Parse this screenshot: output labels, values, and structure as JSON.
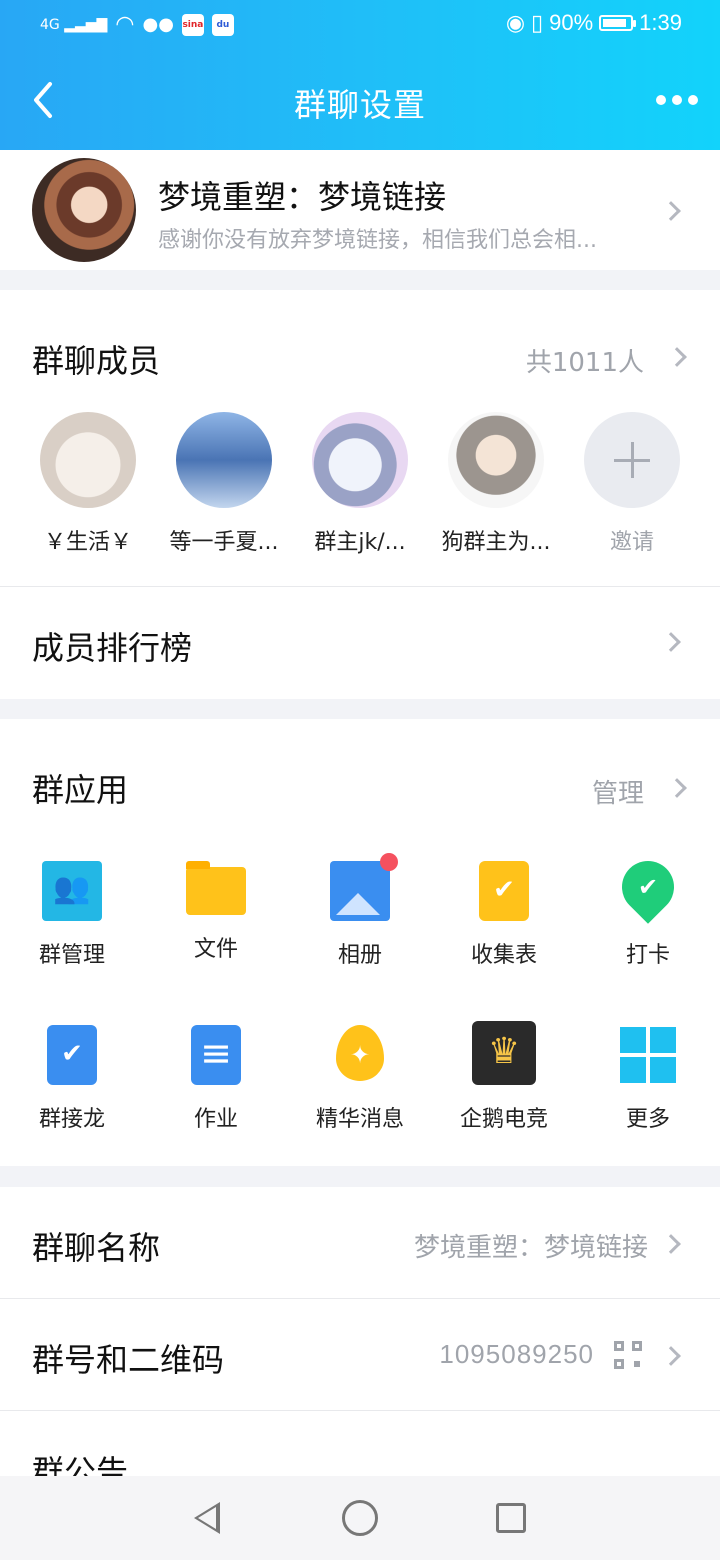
{
  "status_bar": {
    "network": "4G",
    "battery": "90%",
    "battery_level": 0.9,
    "time": "1:39",
    "sina_label": "sina"
  },
  "nav": {
    "title": "群聊设置"
  },
  "group": {
    "name": "梦境重塑：梦境链接",
    "description": "感谢你没有放弃梦境链接，相信我们总会相..."
  },
  "members": {
    "title": "群聊成员",
    "count": "共1011人",
    "list": [
      {
        "name": "￥生活￥"
      },
      {
        "name": "等一手夏..."
      },
      {
        "name": "群主jk/..."
      },
      {
        "name": "狗群主为..."
      }
    ],
    "invite_label": "邀请"
  },
  "ranking": {
    "label": "成员排行榜"
  },
  "apps": {
    "title": "群应用",
    "manage": "管理",
    "items": [
      {
        "label": "群管理",
        "icon": "group-manage-icon"
      },
      {
        "label": "文件",
        "icon": "folder-icon"
      },
      {
        "label": "相册",
        "icon": "album-icon"
      },
      {
        "label": "收集表",
        "icon": "collect-form-icon"
      },
      {
        "label": "打卡",
        "icon": "check-in-icon"
      },
      {
        "label": "群接龙",
        "icon": "relay-icon"
      },
      {
        "label": "作业",
        "icon": "homework-icon"
      },
      {
        "label": "精华消息",
        "icon": "essence-icon"
      },
      {
        "label": "企鹅电竞",
        "icon": "esports-icon"
      },
      {
        "label": "更多",
        "icon": "more-apps-icon"
      }
    ]
  },
  "settings": {
    "group_name_label": "群聊名称",
    "group_name_value": "梦境重塑：梦境链接",
    "group_id_label": "群号和二维码",
    "group_id_value": "1095089250",
    "announcement_label": "群公告"
  },
  "colors": {
    "header_start": "#28a7f5",
    "header_end": "#12d3fb",
    "badge_red": "#f5515f"
  }
}
